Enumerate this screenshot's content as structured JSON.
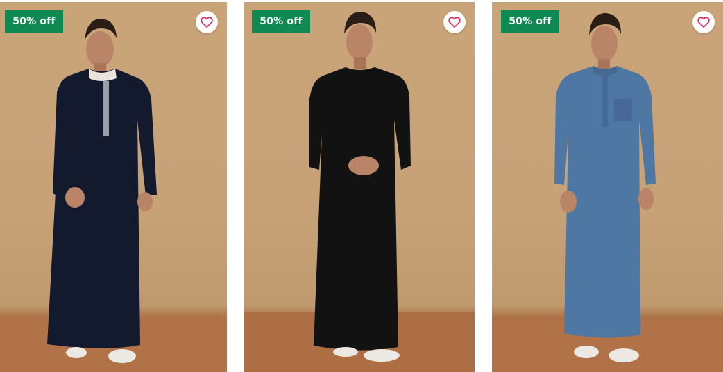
{
  "products": [
    {
      "badge": "50% off",
      "wishlist_icon": "heart-outline-icon",
      "image": "model-in-navy-thobe-with-embroidered-placket",
      "garment_color": "#141a2e"
    },
    {
      "badge": "50% off",
      "wishlist_icon": "heart-outline-icon",
      "image": "model-in-black-thobe",
      "garment_color": "#111111"
    },
    {
      "badge": "50% off",
      "wishlist_icon": "heart-outline-icon",
      "image": "model-in-denim-blue-thobe",
      "garment_color": "#4f77a4"
    }
  ],
  "colors": {
    "badge_bg": "#0e8a52",
    "heart": "#e0245e",
    "backdrop": "#c9a479",
    "floor": "#b47549"
  }
}
